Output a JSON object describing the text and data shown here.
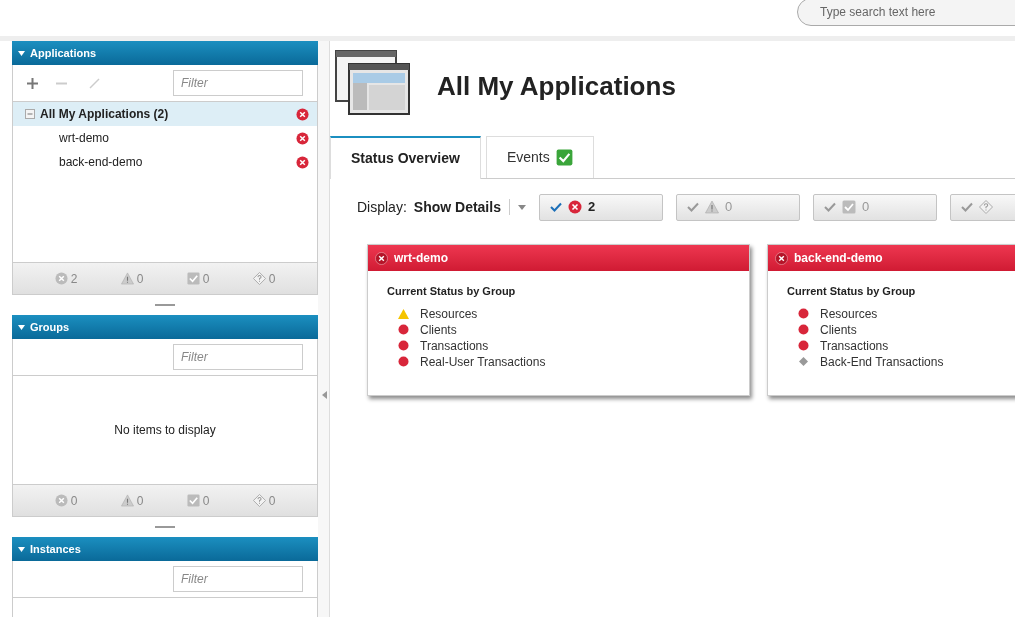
{
  "search": {
    "placeholder": "Type search text here"
  },
  "sidebar": {
    "panels": [
      {
        "title": "Applications",
        "expanded": true,
        "toolbar": true,
        "filter_placeholder": "Filter",
        "tree": [
          {
            "label": "All My Applications (2)",
            "expanded": true,
            "selected": true,
            "kind": "error",
            "children": [
              {
                "label": "wrt-demo",
                "selected": false,
                "kind": "error"
              },
              {
                "label": "back-end-demo",
                "selected": false,
                "kind": "error"
              }
            ]
          }
        ],
        "counts": [
          {
            "kind": "error",
            "count": "2"
          },
          {
            "kind": "warning",
            "count": "0"
          },
          {
            "kind": "ok",
            "count": "0"
          },
          {
            "kind": "unknown",
            "count": "0"
          }
        ]
      },
      {
        "title": "Groups",
        "expanded": true,
        "toolbar": false,
        "filter_placeholder": "Filter",
        "empty_message": "No items to display",
        "counts": [
          {
            "kind": "error",
            "count": "0"
          },
          {
            "kind": "warning",
            "count": "0"
          },
          {
            "kind": "ok",
            "count": "0"
          },
          {
            "kind": "unknown",
            "count": "0"
          }
        ]
      },
      {
        "title": "Instances",
        "expanded": true,
        "toolbar": false,
        "filter_placeholder": "Filter"
      }
    ]
  },
  "main": {
    "title": "All My Applications",
    "tabs": [
      {
        "label": "Status Overview",
        "selected": true
      },
      {
        "label": "Events",
        "selected": false,
        "kind": "ok"
      }
    ],
    "display": {
      "label": "Display:",
      "value": "Show Details"
    },
    "filters": [
      {
        "kind": "error",
        "selected": true,
        "count": "2"
      },
      {
        "kind": "warning",
        "selected": false,
        "count": "0"
      },
      {
        "kind": "ok",
        "selected": false,
        "count": "0"
      },
      {
        "kind": "unknown",
        "selected": false
      }
    ],
    "cards": [
      {
        "title": "wrt-demo",
        "kind": "error",
        "subtitle": "Current Status by Group",
        "groups": [
          {
            "label": "Resources",
            "kind": "warning"
          },
          {
            "label": "Clients",
            "kind": "error"
          },
          {
            "label": "Transactions",
            "kind": "error"
          },
          {
            "label": "Real-User Transactions",
            "kind": "error"
          }
        ]
      },
      {
        "title": "back-end-demo",
        "kind": "error",
        "subtitle": "Current Status by Group",
        "groups": [
          {
            "label": "Resources",
            "kind": "error"
          },
          {
            "label": "Clients",
            "kind": "error"
          },
          {
            "label": "Transactions",
            "kind": "error"
          },
          {
            "label": "Back-End Transactions",
            "kind": "unknown"
          }
        ]
      }
    ]
  }
}
